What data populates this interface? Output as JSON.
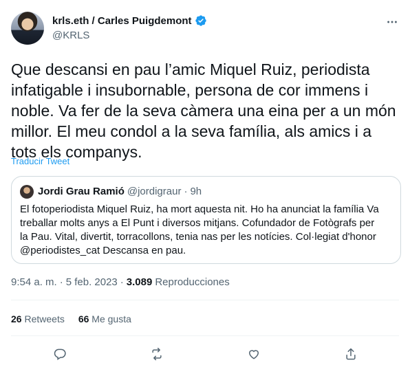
{
  "author": {
    "display_name": "krls.eth / Carles Puigdemont",
    "handle": "@KRLS"
  },
  "tweet": {
    "text": "Que descansi en pau l’amic Miquel Ruiz, periodista\ninfatigable i insubornable, persona de cor immens i\nnoble. Va fer de la seva càmera una eina per a un món\nmillor. El meu condol a la seva família, als amics i a\ntots els companys.",
    "translate_label": "Traducir Tweet"
  },
  "quoted": {
    "name": "Jordi Grau Ramió",
    "handle": "@jordigraur",
    "separator": "·",
    "time": "9h",
    "text": "El fotoperiodista Miquel Ruiz, ha mort aquesta nit. Ho ha anunciat la família  Va\ntreballar molts anys a El Punt i diversos mitjans. Cofundador de Fotògrafs per\nla Pau. Vital, divertit, torracollons, tenia nas per les notícies. Col·legiat d'honor\n@periodistes_cat Descansa en pau."
  },
  "meta": {
    "time": "9:54 a. m.",
    "sep1": "·",
    "date": "5 feb. 2023",
    "sep2": "·",
    "views_count": "3.089",
    "views_label": "Reproducciones"
  },
  "stats": {
    "retweets_count": "26",
    "retweets_label": "Retweets",
    "likes_count": "66",
    "likes_label": "Me gusta"
  },
  "icons": {
    "verified": "verified-badge-icon",
    "more": "more-icon",
    "reply": "reply-icon",
    "retweet": "retweet-icon",
    "like": "heart-icon",
    "share": "share-icon"
  },
  "colors": {
    "accent": "#1d9bf0",
    "text": "#0f1419",
    "secondary": "#536471"
  }
}
